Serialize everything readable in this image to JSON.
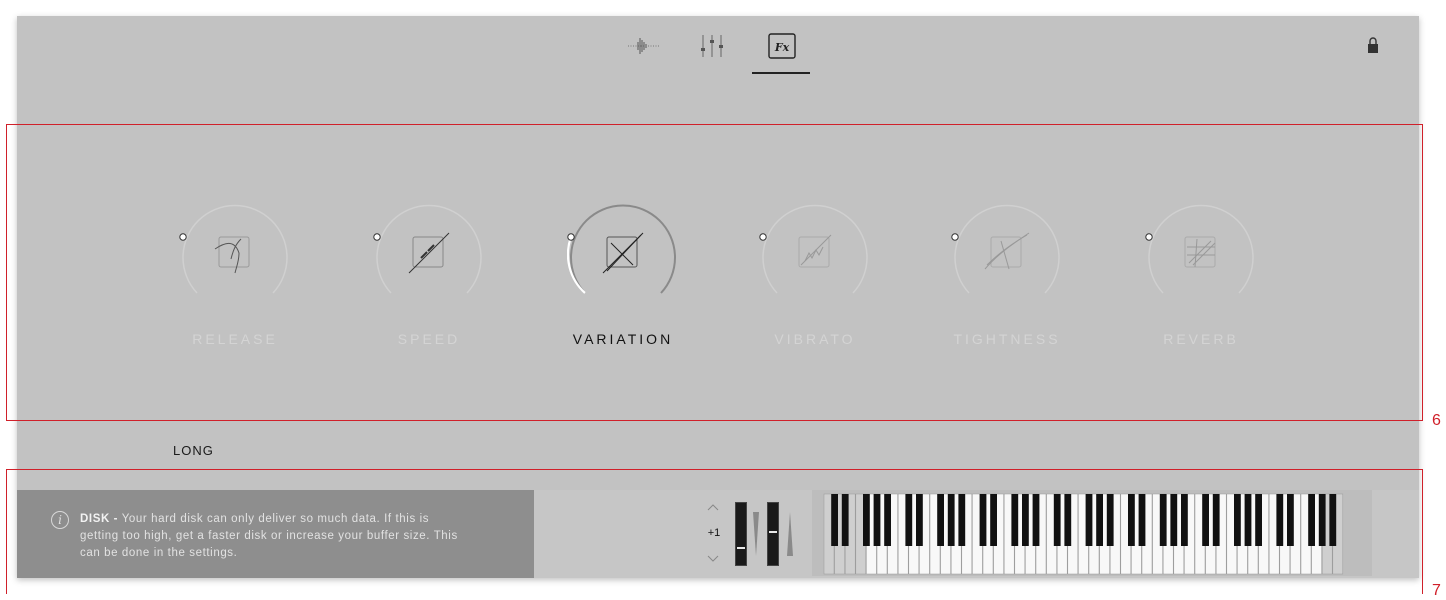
{
  "nav": {
    "tabs": [
      {
        "name": "waveform-icon",
        "active": false
      },
      {
        "name": "mixer-icon",
        "active": false
      },
      {
        "name": "fx-icon",
        "label": "Fx",
        "active": true
      }
    ]
  },
  "knobs": [
    {
      "label": "RELEASE",
      "active": false,
      "value": 0
    },
    {
      "label": "SPEED",
      "active": false,
      "value": 0
    },
    {
      "label": "VARIATION",
      "active": true,
      "value": 0.3
    },
    {
      "label": "VIBRATO",
      "active": false,
      "value": 0
    },
    {
      "label": "TIGHTNESS",
      "active": false,
      "value": 0
    },
    {
      "label": "REVERB",
      "active": false,
      "value": 0
    }
  ],
  "section": {
    "label": "LONG"
  },
  "info": {
    "title": "DISK -",
    "body": " Your hard disk can only deliver so much data. If this is getting too high, get a faster disk or increase your buffer size. This can be done in the settings."
  },
  "octave": {
    "value": "+1"
  },
  "annotations": {
    "six": "6",
    "seven": "7"
  },
  "colors": {
    "panel": "#c2c2c2",
    "active_text": "#111111",
    "inactive_text": "#d4d4d4",
    "annotation_red": "#d0202a"
  }
}
